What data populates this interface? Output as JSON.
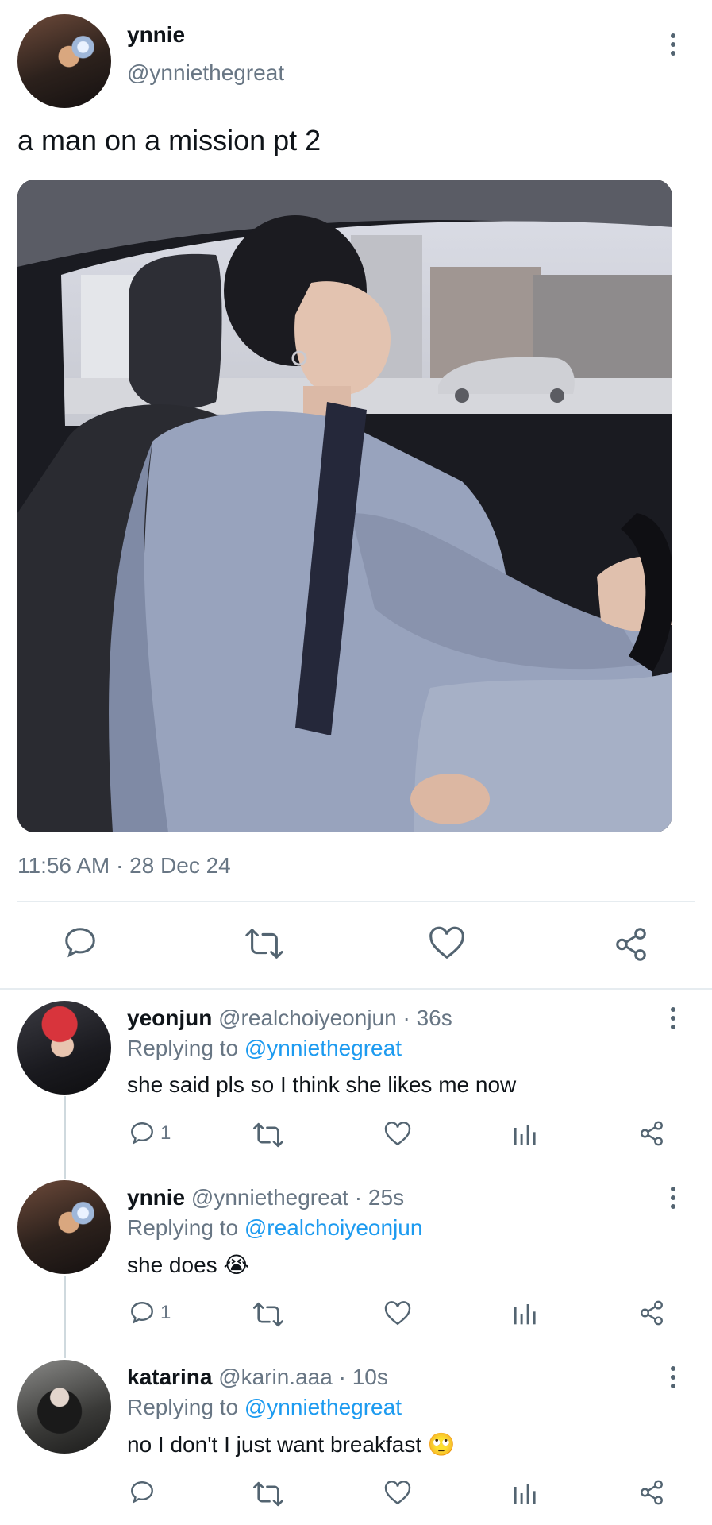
{
  "main_tweet": {
    "display_name": "ynnie",
    "handle": "@ynniethegreat",
    "text": "a man on a mission pt 2",
    "timestamp": "11:56 AM · 28 Dec 24",
    "avatar_icon": "profile-photo",
    "actions": [
      "reply-icon",
      "retweet-icon",
      "like-icon",
      "share-icon"
    ]
  },
  "replies": [
    {
      "display_name": "yeonjun",
      "handle": "@realchoiyeonjun",
      "age": "36s",
      "replying_label": "Replying to",
      "replying_to": "@ynniethegreat",
      "text": "she said pls so I think she likes me now",
      "reply_count": "1"
    },
    {
      "display_name": "ynnie",
      "handle": "@ynniethegreat",
      "age": "25s",
      "replying_label": "Replying to",
      "replying_to": "@realchoiyeonjun",
      "text": "she does 😭",
      "reply_count": "1"
    },
    {
      "display_name": "katarina",
      "handle": "@karin.aaa",
      "age": "10s",
      "replying_label": "Replying to",
      "replying_to": "@ynniethegreat",
      "text": "no I don't I just want breakfast 🙄",
      "reply_count": ""
    }
  ],
  "colors": {
    "link": "#1d9bf0",
    "muted": "#687684",
    "divider": "#e6ecf0"
  }
}
